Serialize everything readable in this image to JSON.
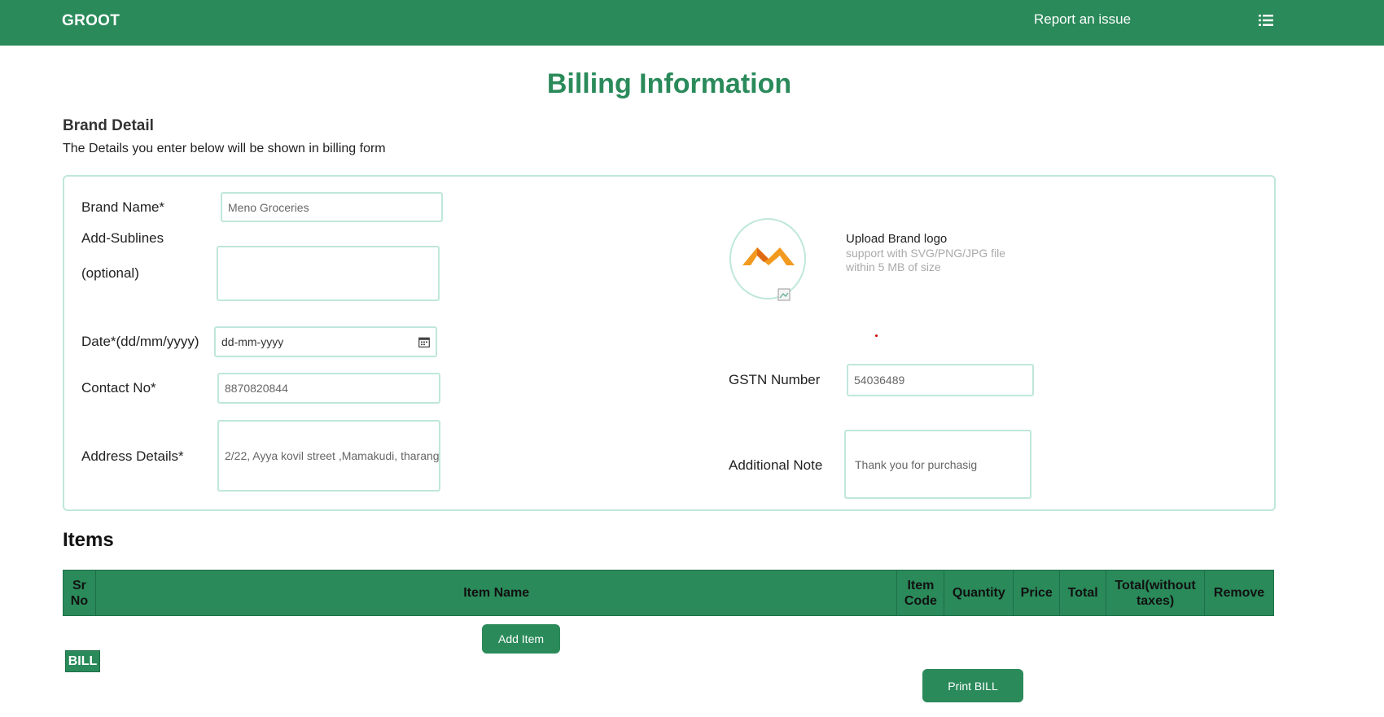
{
  "header": {
    "brand": "GROOT",
    "report_link": "Report an issue",
    "menu_icon": "list-icon"
  },
  "page": {
    "title": "Billing Information"
  },
  "brand_detail": {
    "title": "Brand Detail",
    "subtitle": "The Details you enter below will be shown in billing form",
    "brand_name_label": "Brand Name*",
    "brand_name_value": "Meno Groceries",
    "sublines_label": "Add-Sublines",
    "sublines_optional": "(optional)",
    "sublines_value": "",
    "date_label": "Date*(dd/mm/yyyy)",
    "date_value": "dd-mm-yyyy",
    "contact_label": "Contact No*",
    "contact_value": "8870820844",
    "address_label": "Address Details*",
    "address_value": "2/22, Ayya kovil street ,Mamakudi, tharang",
    "upload_title": "Upload Brand logo",
    "upload_hint": "support with SVG/PNG/JPG file within 5 MB of size",
    "gstn_label": "GSTN Number",
    "gstn_value": "54036489",
    "note_label": "Additional Note",
    "note_value": "Thank you for purchasig",
    "logo_color": "#f29a1f"
  },
  "items": {
    "title": "Items",
    "columns": [
      "Sr No",
      "Item Name",
      "Item Code",
      "Quantity",
      "Price",
      "Total",
      "Total(without taxes)",
      "Remove"
    ],
    "add_button": "Add Item",
    "bill_tag": "BILL",
    "print_button": "Print BILL"
  },
  "colors": {
    "primary": "#2a8a5a",
    "border": "#bfe7dc"
  }
}
